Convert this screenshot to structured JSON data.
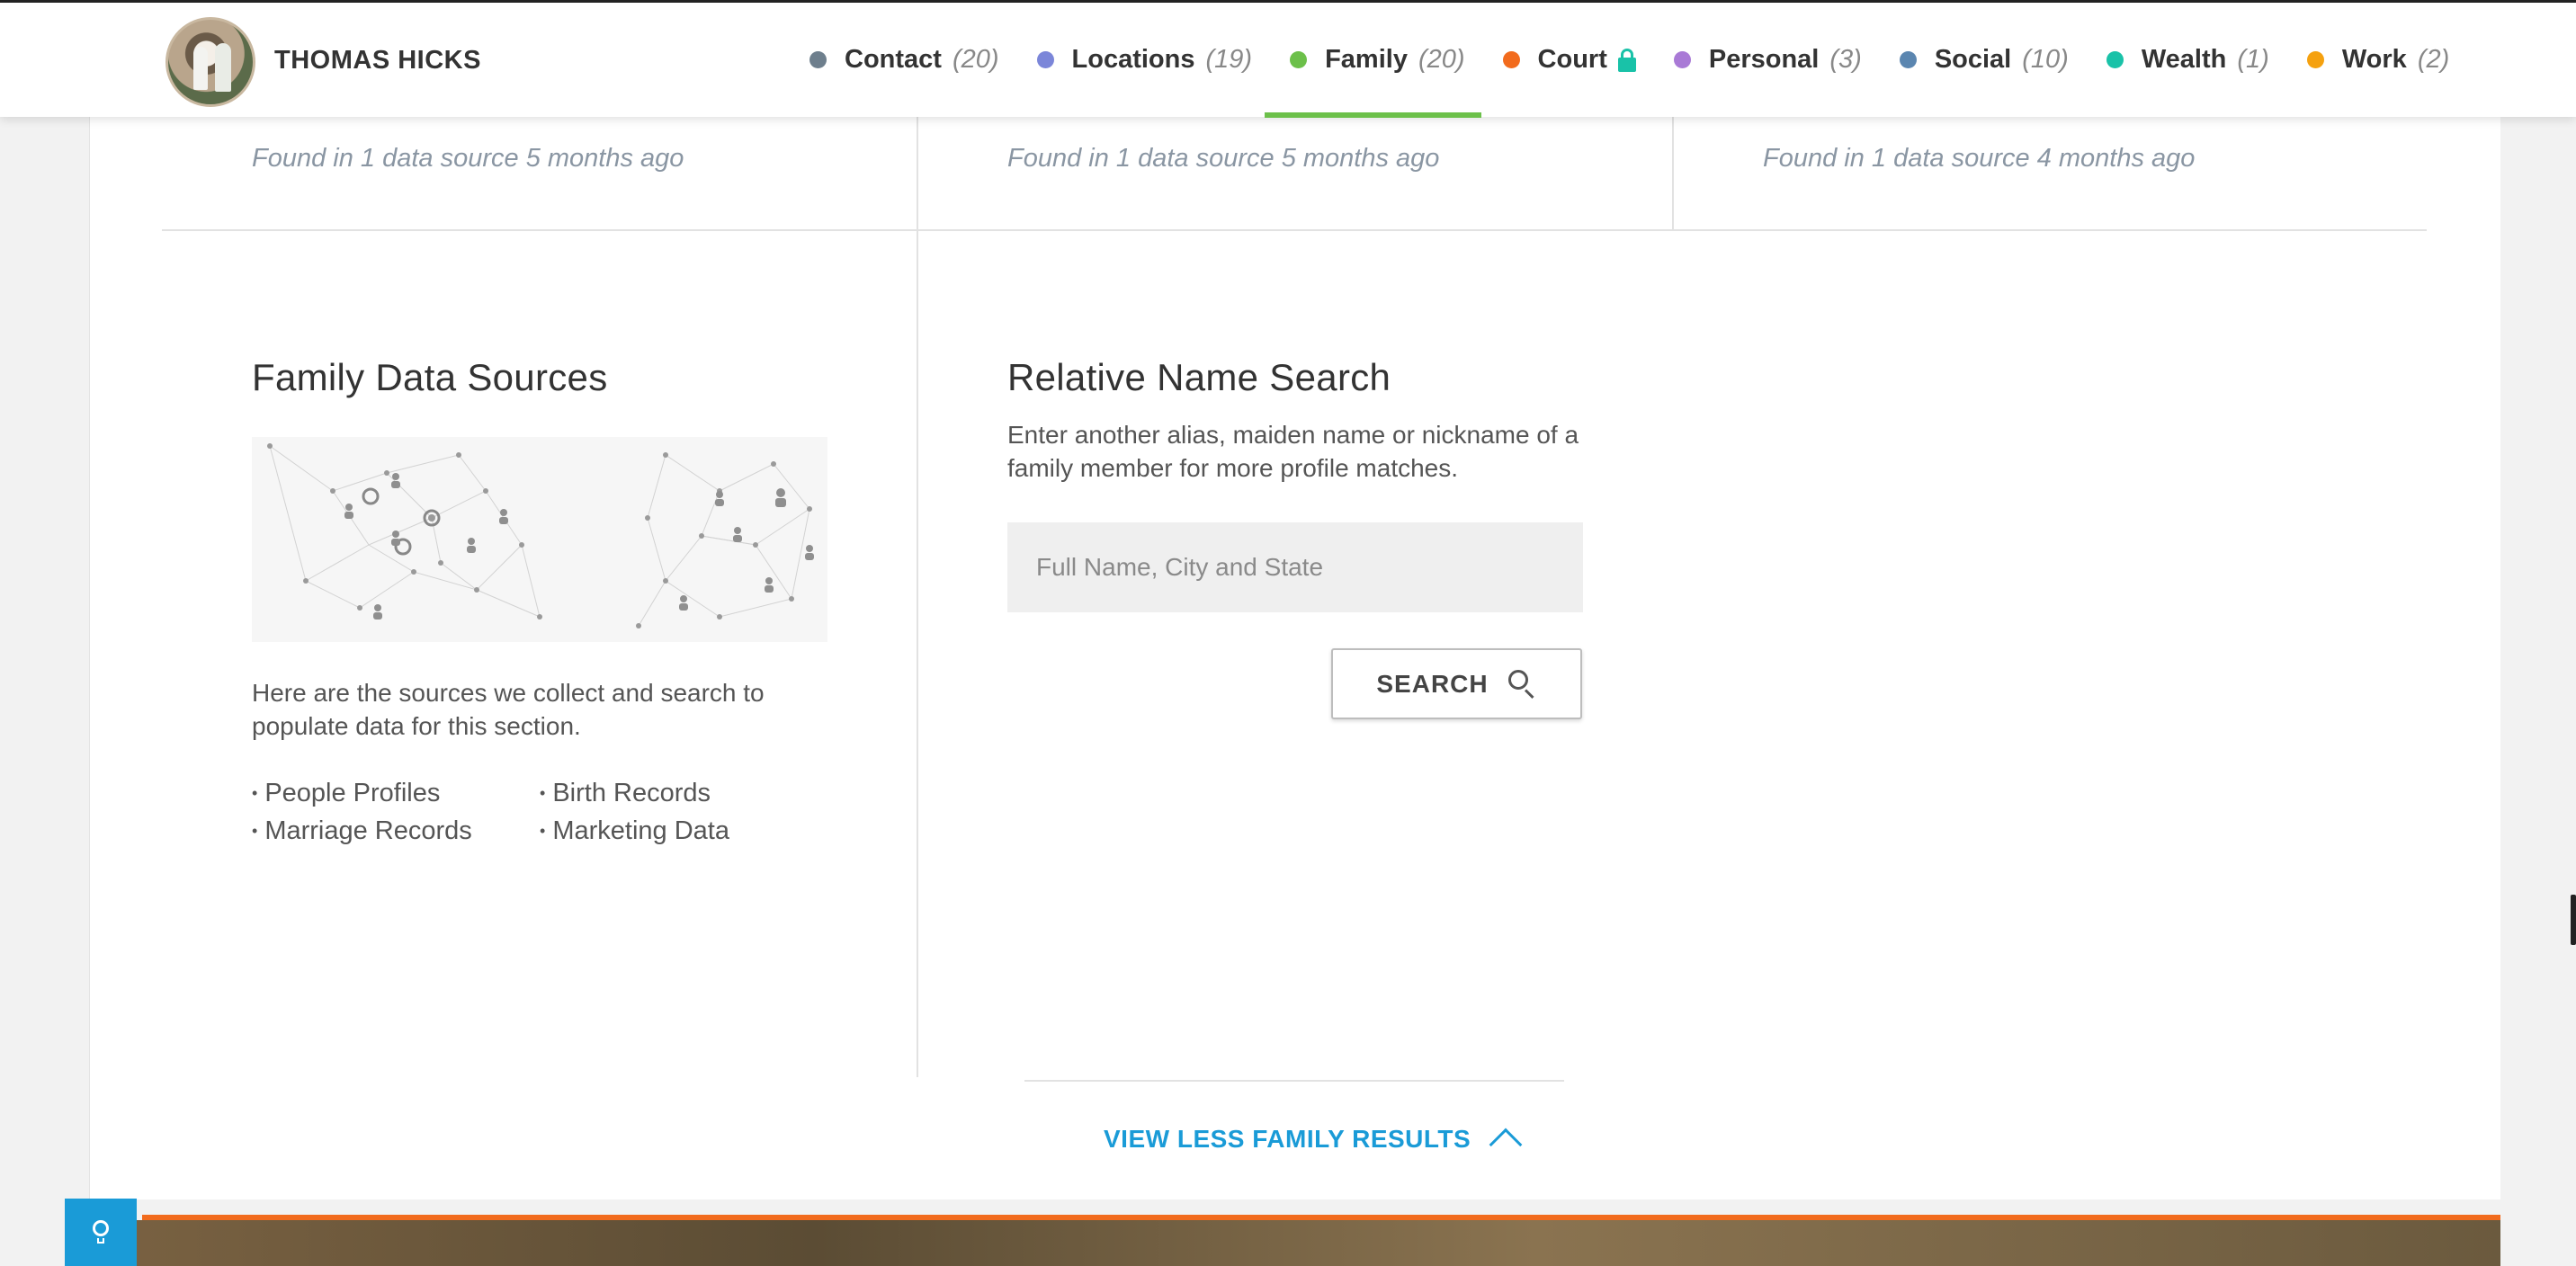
{
  "header": {
    "name": "THOMAS HICKS",
    "nav": [
      {
        "label": "Contact",
        "count": "(20)",
        "color": "#6e7f8d"
      },
      {
        "label": "Locations",
        "count": "(19)",
        "color": "#7b86d9"
      },
      {
        "label": "Family",
        "count": "(20)",
        "color": "#6cc04a",
        "active": true
      },
      {
        "label": "Court",
        "count": "",
        "color": "#f26b1d",
        "locked": true
      },
      {
        "label": "Personal",
        "count": "(3)",
        "color": "#a97ad6"
      },
      {
        "label": "Social",
        "count": "(10)",
        "color": "#5b86b0"
      },
      {
        "label": "Wealth",
        "count": "(1)",
        "color": "#19c2a8"
      },
      {
        "label": "Work",
        "count": "(2)",
        "color": "#f5a10f"
      }
    ]
  },
  "found_rows": [
    "Found in 1 data source 5 months ago",
    "Found in 1 data source 5 months ago",
    "Found in 1 data source 4 months ago"
  ],
  "data_sources": {
    "title": "Family Data Sources",
    "description": "Here are the sources we collect and search to populate data for this section.",
    "items": [
      "People Profiles",
      "Birth Records",
      "Marriage Records",
      "Marketing Data"
    ]
  },
  "relative_search": {
    "title": "Relative Name Search",
    "description": "Enter another alias, maiden name or nickname of a family member for more profile matches.",
    "placeholder": "Full Name, City and State",
    "button_label": "SEARCH"
  },
  "view_less_label": "VIEW LESS FAMILY RESULTS",
  "colors": {
    "accent_blue": "#1a9bd7",
    "active_green": "#6cc04a",
    "court_orange": "#f26b1d"
  }
}
